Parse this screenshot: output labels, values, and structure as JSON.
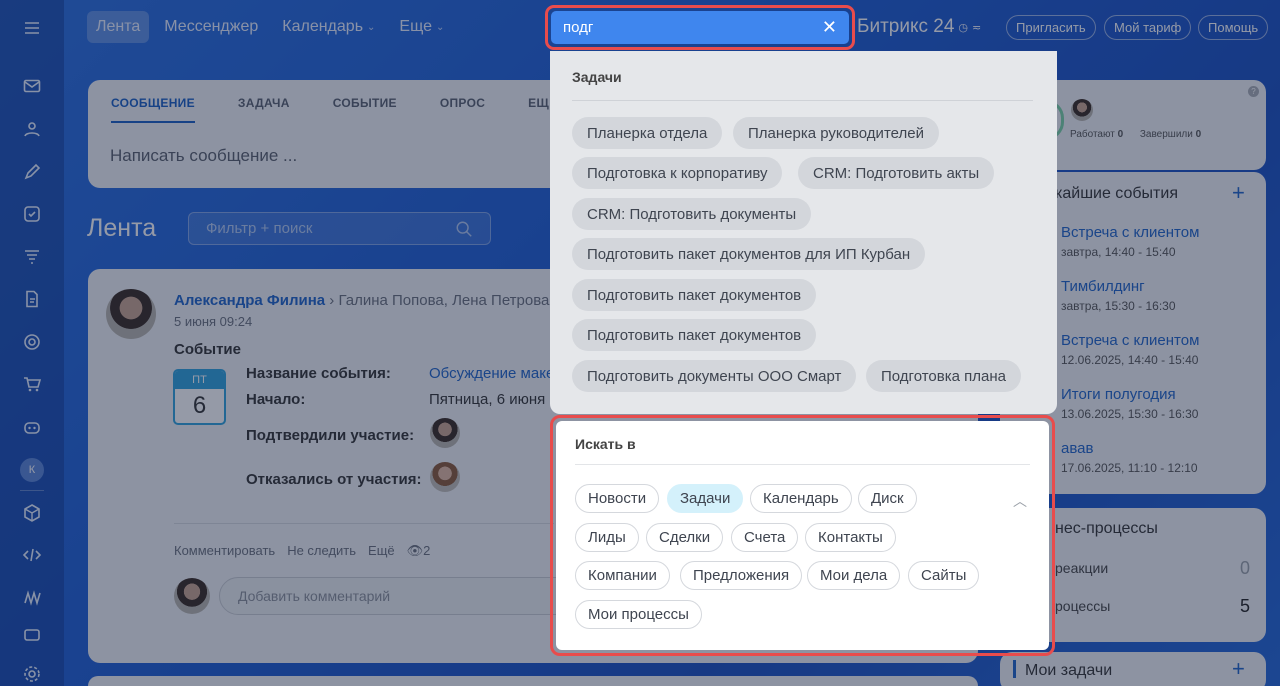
{
  "topnav": {
    "tabs": [
      {
        "label": "Лента",
        "active": true
      },
      {
        "label": "Мессенджер"
      },
      {
        "label": "Календарь",
        "dropdown": true
      },
      {
        "label": "Еще",
        "dropdown": true
      }
    ],
    "brand": "Битрикс 24",
    "invite": "Пригласить",
    "tariff": "Мой тариф",
    "help": "Помощь"
  },
  "search": {
    "value": "подг"
  },
  "composer": {
    "tabs": [
      "СООБЩЕНИЕ",
      "ЗАДАЧА",
      "СОБЫТИЕ",
      "ОПРОС",
      "ЕЩ"
    ],
    "placeholder": "Написать сообщение ..."
  },
  "feed": {
    "title": "Лента",
    "filter_placeholder": "Фильтр + поиск",
    "post": {
      "author": "Александра Филина",
      "recipients": "Галина Попова, Лена Петрова",
      "date": "5 июня 09:24",
      "type": "Событие",
      "cal_dow": "ПТ",
      "cal_day": "6",
      "event_name_label": "Название события:",
      "event_name": "Обсуждение маке",
      "start_label": "Начало:",
      "start_value": "Пятница, 6 июня 2",
      "confirmed_label": "Подтвердили участие:",
      "declined_label": "Отказались от участия:",
      "actions": {
        "comment": "Комментировать",
        "unfollow": "Не следить",
        "more": "Ещё",
        "views": "2"
      },
      "comment_placeholder": "Добавить комментарий"
    }
  },
  "right": {
    "working_label": "Работают",
    "working_count": "0",
    "finished_label": "Завершили",
    "finished_count": "0",
    "events_title": "кайшие события",
    "events": [
      {
        "title": "Встреча с клиентом",
        "time": "завтра, 14:40 - 15:40"
      },
      {
        "title": "Тимбилдинг",
        "time": "завтра, 15:30 - 16:30"
      },
      {
        "title": "Встреча с клиентом",
        "time": "12.06.2025, 14:40 - 15:40"
      },
      {
        "title": "Итоги полугодия",
        "time": "13.06.2025, 15:30 - 16:30"
      },
      {
        "title": "авав",
        "time": "17.06.2025, 11:10 - 12:10"
      }
    ],
    "bp_title": "нес-процессы",
    "bp_rows": [
      {
        "label": "реакции",
        "value": "0"
      },
      {
        "label": "роцессы",
        "value": "5"
      }
    ],
    "tasks_title": "Мои задачи",
    "rail_avatar_letter": "К"
  },
  "dropdown": {
    "heading": "Задачи",
    "results": [
      "Планерка отдела",
      "Планерка руководителей",
      "Подготовка к корпоративу",
      "CRM: Подготовить акты",
      "CRM: Подготовить документы",
      "Подготовить пакет документов для ИП Курбан",
      "Подготовить пакет документов",
      "Подготовить пакет документов",
      "Подготовить документы ООО Смарт",
      "Подготовка плана"
    ]
  },
  "scope": {
    "heading": "Искать в",
    "tags": [
      "Новости",
      "Задачи",
      "Календарь",
      "Диск",
      "Лиды",
      "Сделки",
      "Счета",
      "Контакты",
      "Компании",
      "Предложения",
      "Мои дела",
      "Сайты",
      "Мои процессы"
    ],
    "selected": "Задачи"
  }
}
